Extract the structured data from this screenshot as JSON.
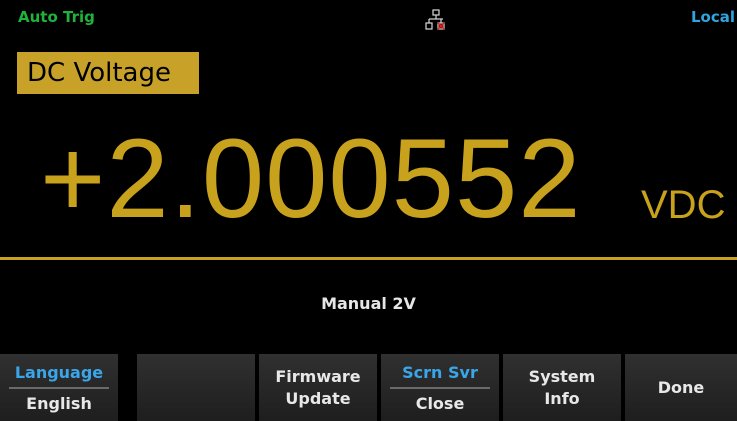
{
  "status": {
    "trigger": "Auto Trig",
    "network_icon": "lan-disconnected-icon",
    "remote": "Local"
  },
  "display": {
    "function": "DC Voltage",
    "reading": "+2.000552",
    "unit": "VDC",
    "range": "Manual 2V"
  },
  "softkeys": {
    "language": {
      "title": "Language",
      "value": "English"
    },
    "firmware": {
      "line1": "Firmware",
      "line2": "Update"
    },
    "screen_saver": {
      "title": "Scrn Svr",
      "value": "Close"
    },
    "system_info": {
      "line1": "System",
      "line2": "Info"
    },
    "done": {
      "label": "Done"
    }
  },
  "colors": {
    "reading": "#c8a21c",
    "function_bg": "#c8a228",
    "trigger": "#1fb33b",
    "remote": "#2fa5e0",
    "softkey_title": "#3aa6ea",
    "background": "#000000"
  }
}
